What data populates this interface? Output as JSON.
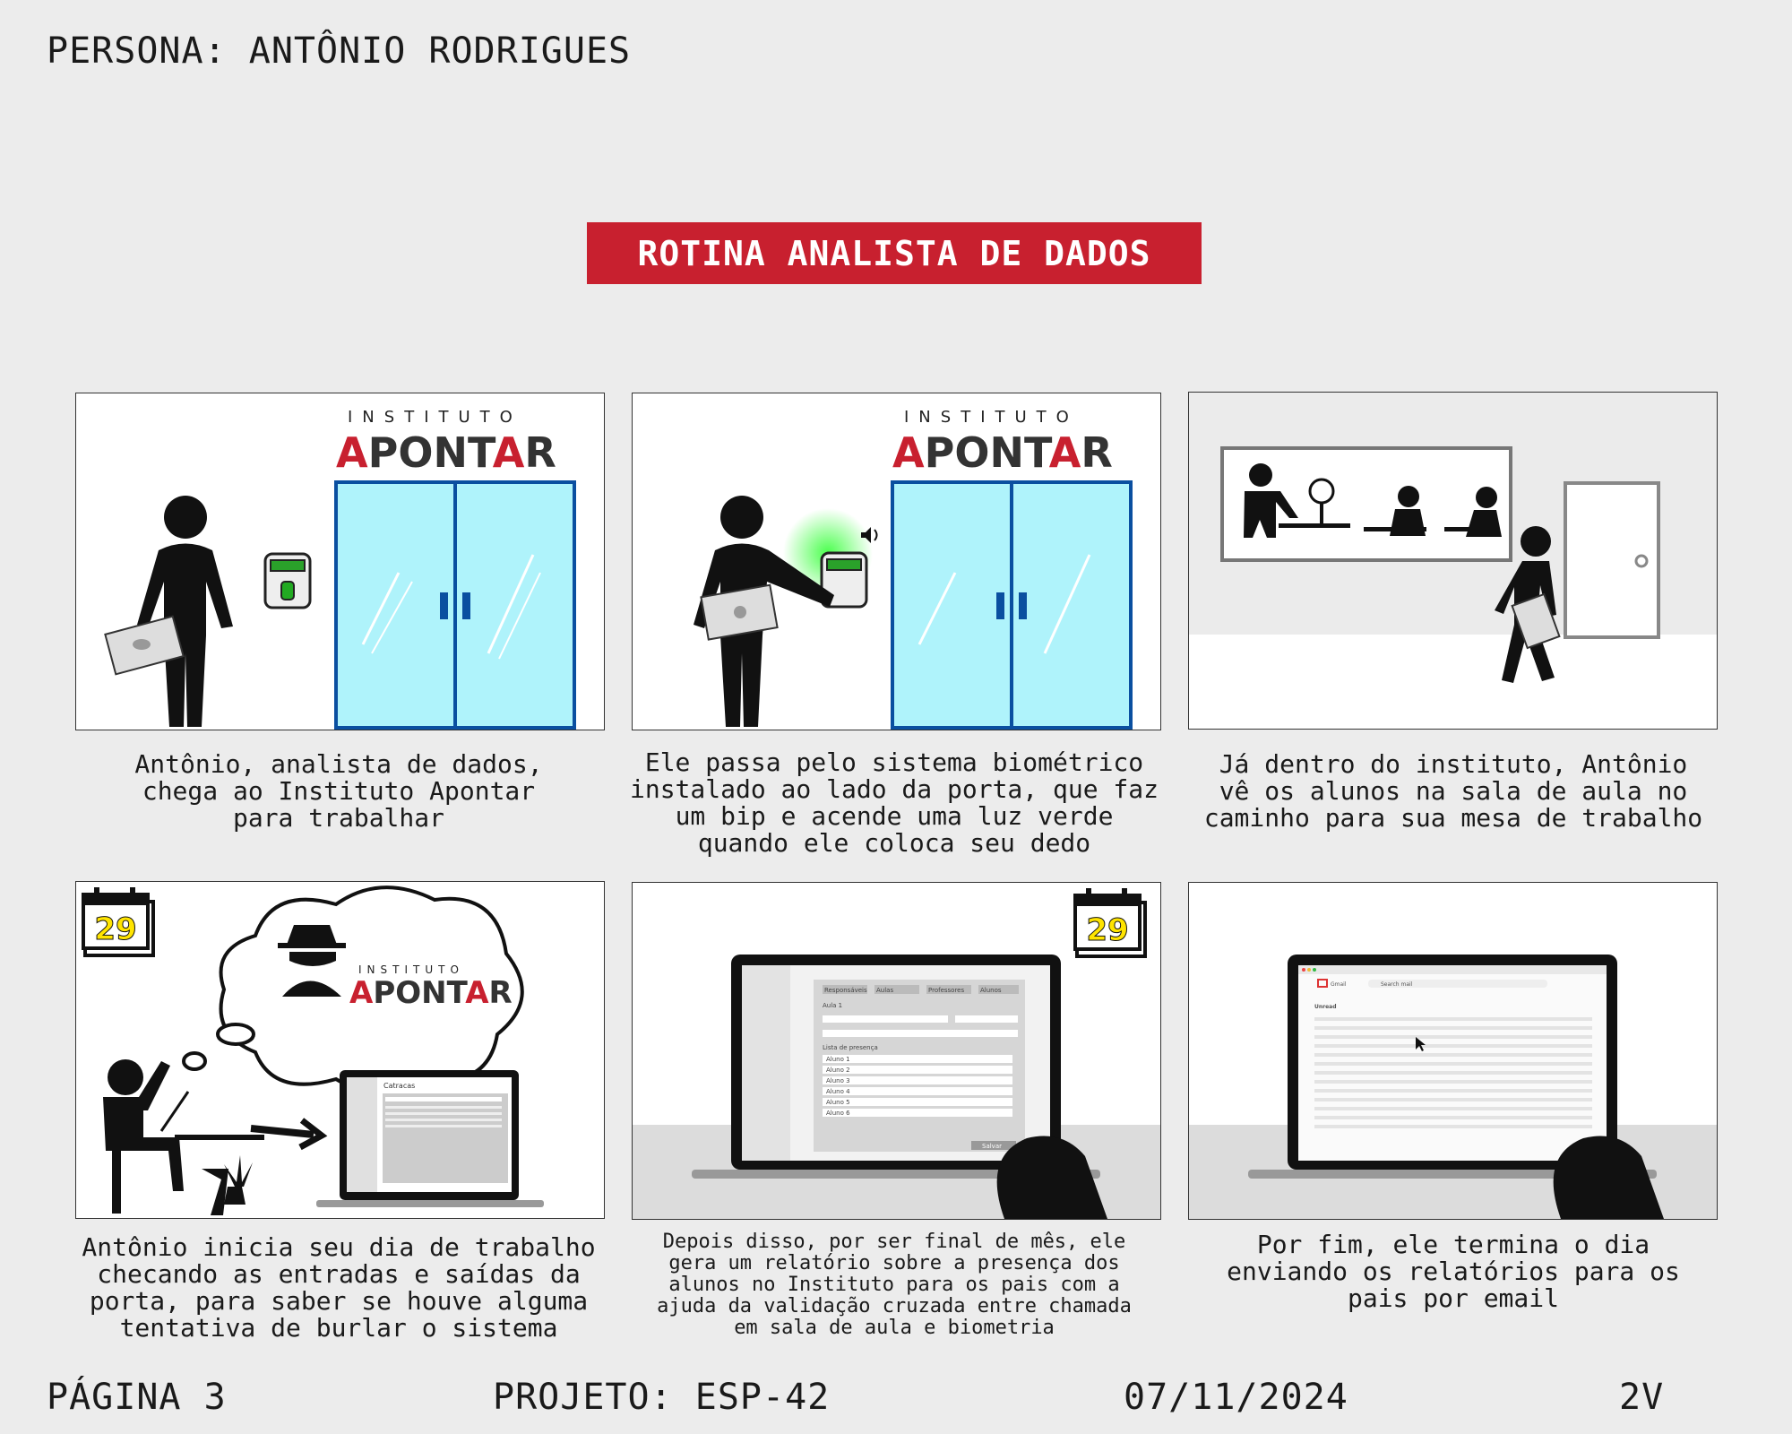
{
  "header": {
    "persona": "PERSONA: ANTÔNIO RODRIGUES"
  },
  "banner": {
    "title": "ROTINA ANALISTA DE DADOS"
  },
  "logo": {
    "top": "INSTITUTO",
    "main": "APONTAR"
  },
  "panels": [
    {
      "caption": "Antônio, analista de dados,\nchega ao Instituto Apontar\npara trabalhar"
    },
    {
      "caption": "Ele passa pelo sistema biométrico\ninstalado ao lado da porta, que faz\num bip e acende uma luz verde\nquando ele coloca seu dedo"
    },
    {
      "caption": "Já dentro do instituto, Antônio\nvê os alunos na sala de aula no\ncaminho para sua mesa de trabalho"
    },
    {
      "caption": "Antônio inicia seu dia de trabalho\nchecando as entradas e saídas da\nporta, para saber se houve alguma\ntentativa de burlar o sistema",
      "calendar_day": "29"
    },
    {
      "caption": "Depois disso, por ser final de mês, ele\ngera um relatório sobre a presença dos\nalunos no Instituto para os pais com a\najuda da validação cruzada entre chamada\nem sala de aula e biometria",
      "calendar_day": "29"
    },
    {
      "caption": "Por fim, ele termina o dia\nenviando os relatórios para os\npais por email"
    }
  ],
  "screens": {
    "catracas_title": "Catracas",
    "attendance": {
      "tabs": [
        "Responsáveis",
        "Aulas",
        "Professores",
        "Alunos"
      ],
      "heading": "Aula 1",
      "list_title": "Lista de presença",
      "rows": [
        "Aluno 1",
        "Aluno 2",
        "Aluno 3",
        "Aluno 4",
        "Aluno 5",
        "Aluno 6"
      ],
      "button": "Salvar"
    },
    "gmail": {
      "brand": "Gmail",
      "search": "Search mail",
      "section": "Unread"
    }
  },
  "footer": {
    "page": "PÁGINA 3",
    "project": "PROJETO: ESP-42",
    "date": "07/11/2024",
    "version": "2V"
  },
  "colors": {
    "brand_red": "#c8202f",
    "glass": "#aff3fb",
    "door_frame": "#0a4fa0",
    "calendar_yellow": "#ffe400"
  }
}
